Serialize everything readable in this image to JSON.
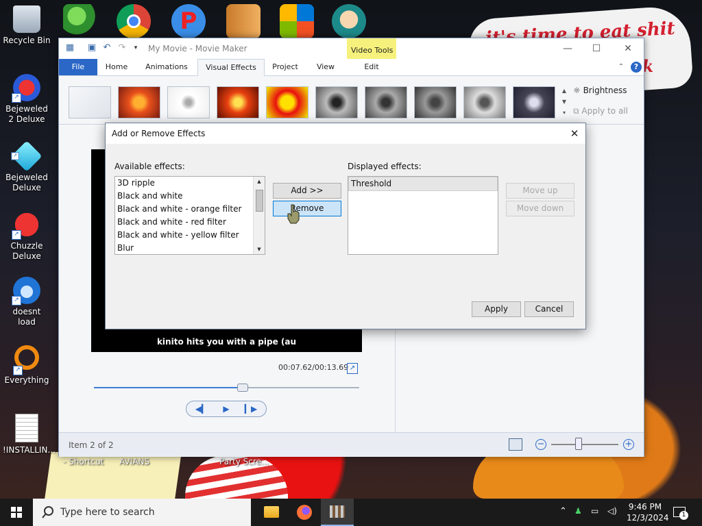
{
  "desktop": {
    "scribble_line1": "it's time to eat shit",
    "scribble_line2": "ck",
    "icons": [
      {
        "label": "Recycle Bin"
      },
      {
        "label": "Bejeweled 2 Deluxe"
      },
      {
        "label": "Bejeweled Deluxe"
      },
      {
        "label": "Chuzzle Deluxe"
      },
      {
        "label": "doesnt load"
      },
      {
        "label": "Everything"
      },
      {
        "label": "!INSTALLIN..."
      }
    ],
    "under_labels": [
      "- Shortcut",
      "AVIANS",
      "Party Scre..."
    ]
  },
  "movie_maker": {
    "title": "My Movie - Movie Maker",
    "video_tools_label": "Video Tools",
    "tabs": [
      {
        "label": "File"
      },
      {
        "label": "Home"
      },
      {
        "label": "Animations"
      },
      {
        "label": "Visual Effects"
      },
      {
        "label": "Project"
      },
      {
        "label": "View"
      },
      {
        "label": "Edit"
      }
    ],
    "brightness_label": "Brightness",
    "apply_all_label": "Apply to all",
    "caption": "kinito hits you with a pipe (au",
    "timecode": "00:07.62/00:13.69",
    "seek_fraction": 0.557,
    "zoom_fraction": 0.4,
    "status_text": "Item 2 of 2"
  },
  "dialog": {
    "title": "Add or Remove Effects",
    "available_label": "Available effects:",
    "available_items": [
      "3D ripple",
      "Black and white",
      "Black and white - orange filter",
      "Black and white - red filter",
      "Black and white - yellow filter",
      "Blur"
    ],
    "displayed_label": "Displayed effects:",
    "displayed_items": [
      "Threshold"
    ],
    "add_label": "Add >>",
    "remove_label": "Remove",
    "move_up_label": "Move up",
    "move_down_label": "Move down",
    "apply_label": "Apply",
    "cancel_label": "Cancel"
  },
  "taskbar": {
    "search_placeholder": "Type here to search",
    "time": "9:46 PM",
    "date": "12/3/2024",
    "notification_count": "1"
  },
  "colors": {
    "accent": "#2a67c6",
    "video_tools": "#f5f17c",
    "scribble_red": "#d42030"
  }
}
